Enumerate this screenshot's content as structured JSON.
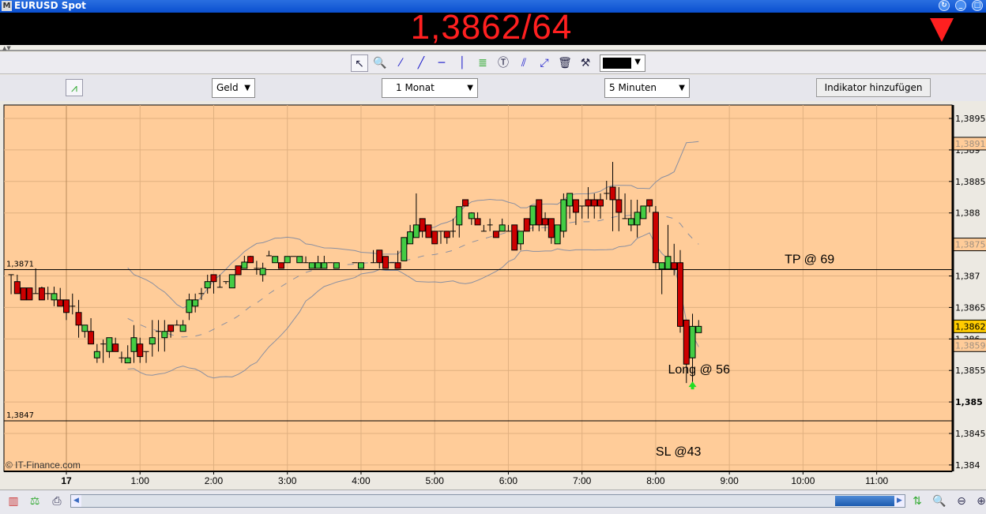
{
  "window": {
    "title": "EURUSD Spot",
    "logo": "M"
  },
  "quote": {
    "price": "1,3862/64",
    "direction": "down",
    "color": "#ff2020"
  },
  "strip": {
    "arrows": "▲▼"
  },
  "toolbar": {
    "tools": [
      "cursor-icon",
      "zoom-icon",
      "line-icon",
      "trendline-icon",
      "horizontal-line-icon",
      "vertical-line-icon",
      "fibonacci-icon",
      "text-icon",
      "channel-icon",
      "parallel-icon",
      "trash-icon",
      "tools-icon"
    ],
    "color": "#000000"
  },
  "controls": {
    "price_type": "Geld",
    "range": "1 Monat",
    "interval": "5 Minuten",
    "add_indicator": "Indikator hinzufügen"
  },
  "chart_data": {
    "type": "candlestick",
    "interval": "5 Minuten",
    "ylim": [
      1.3838,
      1.3898
    ],
    "y_ticks": [
      {
        "v": 1.3895,
        "label": "1,3895"
      },
      {
        "v": 1.389,
        "label": "1,389"
      },
      {
        "v": 1.3885,
        "label": "1,3885"
      },
      {
        "v": 1.388,
        "label": "1,388"
      },
      {
        "v": 1.387,
        "label": "1,387"
      },
      {
        "v": 1.3865,
        "label": "1,3865"
      },
      {
        "v": 1.386,
        "label": "1,386"
      },
      {
        "v": 1.3855,
        "label": "1,3855"
      },
      {
        "v": 1.385,
        "label": "1,385",
        "bold": true
      },
      {
        "v": 1.3845,
        "label": "1,3845"
      },
      {
        "v": 1.384,
        "label": "1,384"
      }
    ],
    "x_ticks": [
      {
        "t": "00:00",
        "label": "17",
        "bold": true
      },
      {
        "t": "01:00",
        "label": "1:00"
      },
      {
        "t": "02:00",
        "label": "2:00"
      },
      {
        "t": "03:00",
        "label": "3:00"
      },
      {
        "t": "04:00",
        "label": "4:00"
      },
      {
        "t": "05:00",
        "label": "5:00"
      },
      {
        "t": "06:00",
        "label": "6:00"
      },
      {
        "t": "07:00",
        "label": "7:00"
      },
      {
        "t": "08:00",
        "label": "8:00"
      },
      {
        "t": "09:00",
        "label": "9:00"
      },
      {
        "t": "10:00",
        "label": "10:00"
      },
      {
        "t": "11:00",
        "label": "11:00"
      }
    ],
    "price_tags": [
      {
        "v": 1.3891,
        "label": "1,3891",
        "style": "band"
      },
      {
        "v": 1.3875,
        "label": "1,3875",
        "style": "band"
      },
      {
        "v": 1.3862,
        "label": "1,3862",
        "style": "current"
      },
      {
        "v": 1.3859,
        "label": "1,3859",
        "style": "band"
      }
    ],
    "hlines": [
      {
        "v": 1.3871,
        "label": "1,3871"
      },
      {
        "v": 1.3847,
        "label": "1,3847"
      }
    ],
    "annotations": [
      {
        "text": "TP @ 69",
        "t": "09:45",
        "v": 1.3872
      },
      {
        "text": "Long @ 56",
        "t": "08:10",
        "v": 1.38545
      },
      {
        "text": "SL @43",
        "t": "08:00",
        "v": 1.38415
      }
    ],
    "entry_marker": {
      "t": "08:30",
      "v": 1.3853,
      "color": "#22dd22"
    },
    "indicator": "Bollinger Bands",
    "watermark": "© IT-Finance.com",
    "colors": {
      "background": "#ffcc99",
      "up": "#44cc44",
      "down": "#cc0000",
      "grid": "#e0b080",
      "band": "#8a8fa0"
    },
    "candles": [
      [
        "23:15",
        1.38702,
        1.38702,
        1.38671,
        1.38702
      ],
      [
        "23:20",
        1.38691,
        1.38702,
        1.38672,
        1.38672
      ],
      [
        "23:25",
        1.38681,
        1.38681,
        1.38662,
        1.38662
      ],
      [
        "23:30",
        1.38681,
        1.38681,
        1.38662,
        1.38662
      ],
      [
        "23:35",
        1.38672,
        1.38712,
        1.38672,
        1.38672
      ],
      [
        "23:40",
        1.38681,
        1.38683,
        1.38662,
        1.38662
      ],
      [
        "23:45",
        1.38672,
        1.38683,
        1.38662,
        1.38672
      ],
      [
        "23:50",
        1.38662,
        1.38683,
        1.38652,
        1.38672
      ],
      [
        "23:55",
        1.38662,
        1.38681,
        1.38652,
        1.38652
      ],
      [
        "00:00",
        1.38662,
        1.38662,
        1.3863,
        1.38642
      ],
      [
        "00:05",
        1.38652,
        1.38672,
        1.38639,
        1.38652
      ],
      [
        "00:10",
        1.38642,
        1.38662,
        1.38602,
        1.38622
      ],
      [
        "00:15",
        1.38612,
        1.38622,
        1.38602,
        1.38622
      ],
      [
        "00:20",
        1.38612,
        1.38633,
        1.38592,
        1.38592
      ],
      [
        "00:25",
        1.3857,
        1.38592,
        1.38562,
        1.3858
      ],
      [
        "00:30",
        1.38592,
        1.38599,
        1.38562,
        1.38592
      ],
      [
        "00:35",
        1.3858,
        1.38602,
        1.3857,
        1.38602
      ],
      [
        "00:40",
        1.38592,
        1.38602,
        1.3858,
        1.3858
      ],
      [
        "00:45",
        1.3857,
        1.3858,
        1.38562,
        1.3857
      ],
      [
        "00:50",
        1.38562,
        1.3859,
        1.38562,
        1.3857
      ],
      [
        "00:55",
        1.3858,
        1.38622,
        1.38562,
        1.38602
      ],
      [
        "01:00",
        1.38592,
        1.38602,
        1.38562,
        1.38572
      ],
      [
        "01:05",
        1.3858,
        1.3858,
        1.38562,
        1.3858
      ],
      [
        "01:10",
        1.38592,
        1.3863,
        1.38572,
        1.38602
      ],
      [
        "01:15",
        1.38612,
        1.3863,
        1.3858,
        1.38612
      ],
      [
        "01:20",
        1.38602,
        1.3863,
        1.3858,
        1.38612
      ],
      [
        "01:25",
        1.38622,
        1.38622,
        1.38602,
        1.38612
      ],
      [
        "01:30",
        1.38622,
        1.3863,
        1.38622,
        1.38622
      ],
      [
        "01:35",
        1.38612,
        1.3863,
        1.38612,
        1.38622
      ],
      [
        "01:40",
        1.38642,
        1.38672,
        1.3863,
        1.38662
      ],
      [
        "01:45",
        1.38652,
        1.38672,
        1.38642,
        1.38662
      ],
      [
        "01:50",
        1.38672,
        1.38681,
        1.38662,
        1.38672
      ],
      [
        "01:55",
        1.38681,
        1.38702,
        1.38672,
        1.38691
      ],
      [
        "02:00",
        1.38702,
        1.38702,
        1.38672,
        1.38691
      ],
      [
        "02:05",
        1.38682,
        1.38702,
        1.38682,
        1.38682
      ],
      [
        "02:10",
        1.38691,
        1.38691,
        1.38687,
        1.38691
      ],
      [
        "02:15",
        1.38681,
        1.38702,
        1.38681,
        1.38702
      ],
      [
        "02:20",
        1.38716,
        1.38716,
        1.38702,
        1.38702
      ],
      [
        "02:25",
        1.38712,
        1.38732,
        1.38712,
        1.38722
      ],
      [
        "02:30",
        1.38731,
        1.38732,
        1.38721,
        1.38721
      ],
      [
        "02:35",
        1.38712,
        1.38724,
        1.38702,
        1.38712
      ],
      [
        "02:40",
        1.38702,
        1.38721,
        1.38691,
        1.38712
      ],
      [
        "02:45",
        1.38732,
        1.3874,
        1.38732,
        1.38732
      ],
      [
        "02:50",
        1.38721,
        1.38731,
        1.38721,
        1.38731
      ],
      [
        "02:55",
        1.38721,
        1.38721,
        1.38712,
        1.38712
      ],
      [
        "03:00",
        1.38721,
        1.38731,
        1.38721,
        1.38731
      ],
      [
        "03:05",
        1.38731,
        1.38731,
        1.38731,
        1.38731
      ],
      [
        "03:10",
        1.38721,
        1.38731,
        1.38721,
        1.38731
      ],
      [
        "03:15",
        1.38721,
        1.38731,
        1.38721,
        1.38721
      ],
      [
        "03:20",
        1.38712,
        1.38721,
        1.38712,
        1.38721
      ],
      [
        "03:25",
        1.38712,
        1.38732,
        1.38712,
        1.38721
      ],
      [
        "03:30",
        1.38712,
        1.38732,
        1.38712,
        1.38721
      ],
      [
        "03:35",
        1.38721,
        1.38721,
        1.38721,
        1.38721
      ],
      [
        "03:40",
        1.38712,
        1.38721,
        1.38712,
        1.38721
      ],
      [
        "03:55",
        1.38721,
        1.38721,
        1.38721,
        1.38721
      ],
      [
        "04:00",
        1.38712,
        1.38721,
        1.38712,
        1.38721
      ],
      [
        "04:10",
        1.38721,
        1.38741,
        1.38721,
        1.38721
      ],
      [
        "04:15",
        1.38741,
        1.38741,
        1.38712,
        1.38721
      ],
      [
        "04:20",
        1.38731,
        1.38731,
        1.38712,
        1.38712
      ],
      [
        "04:25",
        1.38721,
        1.38721,
        1.38721,
        1.38721
      ],
      [
        "04:30",
        1.38721,
        1.3874,
        1.38712,
        1.38712
      ],
      [
        "04:35",
        1.38724,
        1.38761,
        1.38724,
        1.38761
      ],
      [
        "04:40",
        1.38751,
        1.38781,
        1.38751,
        1.3877
      ],
      [
        "04:45",
        1.38761,
        1.38831,
        1.38761,
        1.38781
      ],
      [
        "04:50",
        1.38791,
        1.38791,
        1.38761,
        1.38771
      ],
      [
        "04:55",
        1.38781,
        1.38781,
        1.38761,
        1.38761
      ],
      [
        "05:00",
        1.38771,
        1.38771,
        1.38751,
        1.38751
      ],
      [
        "05:05",
        1.38771,
        1.38771,
        1.38751,
        1.38771
      ],
      [
        "05:10",
        1.38771,
        1.38771,
        1.38751,
        1.38761
      ],
      [
        "05:15",
        1.38771,
        1.38791,
        1.38761,
        1.38771
      ],
      [
        "05:20",
        1.38781,
        1.3881,
        1.38761,
        1.3881
      ],
      [
        "05:25",
        1.38821,
        1.38821,
        1.38811,
        1.38811
      ],
      [
        "05:30",
        1.38791,
        1.38801,
        1.38781,
        1.388
      ],
      [
        "05:35",
        1.38791,
        1.38801,
        1.38781,
        1.38781
      ],
      [
        "05:40",
        1.38771,
        1.38781,
        1.38771,
        1.38771
      ],
      [
        "05:45",
        1.38781,
        1.38791,
        1.38771,
        1.38781
      ],
      [
        "05:50",
        1.38771,
        1.38771,
        1.38761,
        1.38761
      ],
      [
        "05:55",
        1.38771,
        1.38791,
        1.38771,
        1.38781
      ],
      [
        "06:00",
        1.38771,
        1.38781,
        1.38771,
        1.38771
      ],
      [
        "06:05",
        1.38781,
        1.38781,
        1.38741,
        1.38741
      ],
      [
        "06:10",
        1.38751,
        1.38771,
        1.38741,
        1.38771
      ],
      [
        "06:15",
        1.38791,
        1.38791,
        1.38771,
        1.38771
      ],
      [
        "06:20",
        1.38781,
        1.38811,
        1.38771,
        1.38811
      ],
      [
        "06:25",
        1.38821,
        1.38821,
        1.38771,
        1.38781
      ],
      [
        "06:30",
        1.38791,
        1.38801,
        1.38771,
        1.38781
      ],
      [
        "06:35",
        1.38791,
        1.38791,
        1.38751,
        1.38761
      ],
      [
        "06:40",
        1.38751,
        1.38781,
        1.38751,
        1.38781
      ],
      [
        "06:45",
        1.38771,
        1.38831,
        1.38761,
        1.38821
      ],
      [
        "06:50",
        1.38811,
        1.38831,
        1.38791,
        1.38831
      ],
      [
        "06:55",
        1.38821,
        1.38821,
        1.38781,
        1.38801
      ],
      [
        "07:00",
        1.38811,
        1.38811,
        1.38791,
        1.38811
      ],
      [
        "07:05",
        1.38821,
        1.38841,
        1.38791,
        1.38811
      ],
      [
        "07:10",
        1.38821,
        1.38831,
        1.38791,
        1.38811
      ],
      [
        "07:15",
        1.38821,
        1.38831,
        1.38791,
        1.38811
      ],
      [
        "07:20",
        1.38831,
        1.38851,
        1.38821,
        1.38831
      ],
      [
        "07:25",
        1.38841,
        1.38881,
        1.38771,
        1.38821
      ],
      [
        "07:30",
        1.38821,
        1.38841,
        1.38771,
        1.38801
      ],
      [
        "07:35",
        1.38791,
        1.38831,
        1.38791,
        1.38791
      ],
      [
        "07:40",
        1.38781,
        1.38821,
        1.38771,
        1.38791
      ],
      [
        "07:45",
        1.38781,
        1.38821,
        1.38761,
        1.38801
      ],
      [
        "07:50",
        1.38791,
        1.38811,
        1.38791,
        1.38811
      ],
      [
        "07:55",
        1.38821,
        1.38821,
        1.38801,
        1.38811
      ],
      [
        "08:00",
        1.38801,
        1.38811,
        1.38711,
        1.38721
      ],
      [
        "08:05",
        1.38711,
        1.38721,
        1.38671,
        1.38721
      ],
      [
        "08:10",
        1.38711,
        1.38781,
        1.38711,
        1.38731
      ],
      [
        "08:15",
        1.38721,
        1.38751,
        1.38701,
        1.38711
      ],
      [
        "08:20",
        1.38721,
        1.38741,
        1.3861,
        1.3862
      ],
      [
        "08:25",
        1.3863,
        1.3863,
        1.3853,
        1.3856
      ],
      [
        "08:30",
        1.3857,
        1.3864,
        1.3853,
        1.3862
      ],
      [
        "08:35",
        1.3861,
        1.3863,
        1.3861,
        1.3862
      ]
    ]
  }
}
